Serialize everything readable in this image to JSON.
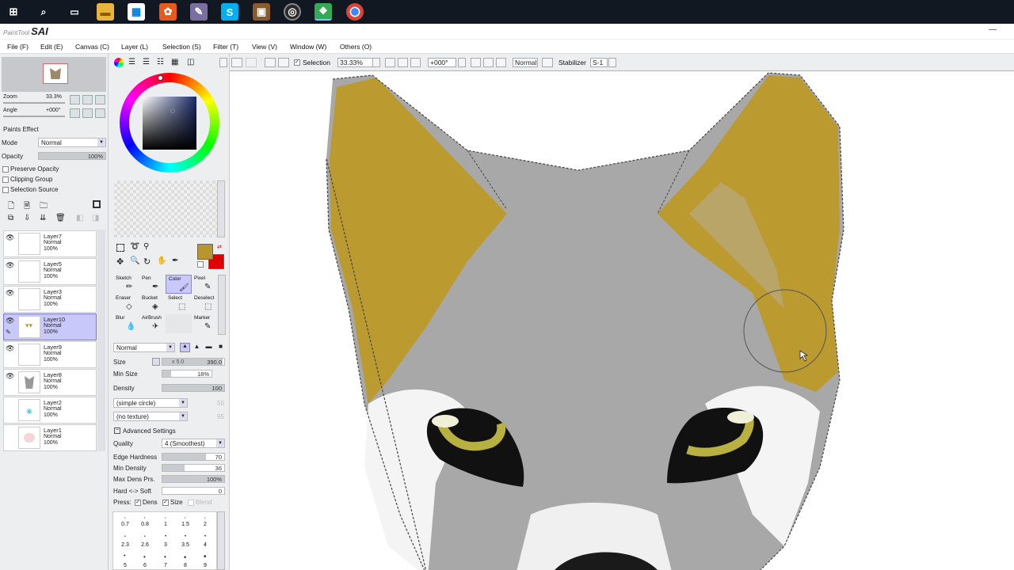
{
  "taskbar": {
    "icons": [
      "windows-icon",
      "search-icon",
      "task-view-icon",
      "file-explorer-icon",
      "store-icon",
      "app-icon",
      "app-icon",
      "skype-icon",
      "app-icon",
      "app-icon",
      "paint-tool-sai-icon",
      "chrome-icon"
    ]
  },
  "title": {
    "brand_small": "PaintTool",
    "brand": "SAI",
    "minimize": "—"
  },
  "menu": [
    {
      "label": "File (F)"
    },
    {
      "label": "Edit (E)"
    },
    {
      "label": "Canvas (C)"
    },
    {
      "label": "Layer (L)"
    },
    {
      "label": "Selection (S)"
    },
    {
      "label": "Filter (T)"
    },
    {
      "label": "View (V)"
    },
    {
      "label": "Window (W)"
    },
    {
      "label": "Others (O)"
    }
  ],
  "navigator": {
    "zoom_label": "Zoom",
    "zoom_value": "33.3%",
    "angle_label": "Angle",
    "angle_value": "+000°"
  },
  "paints": {
    "header": "Paints Effect",
    "mode_label": "Mode",
    "mode_value": "Normal",
    "opacity_label": "Opacity",
    "opacity_value": "100%",
    "opacity_fraction": 1.0,
    "preserve_opacity": "Preserve Opacity",
    "clipping_group": "Clipping Group",
    "selection_source": "Selection Source"
  },
  "layers": [
    {
      "name": "Layer7",
      "mode": "Normal",
      "opacity": "100%",
      "selected": false
    },
    {
      "name": "Layer5",
      "mode": "Normal",
      "opacity": "100%",
      "selected": false
    },
    {
      "name": "Layer3",
      "mode": "Normal",
      "opacity": "100%",
      "selected": false
    },
    {
      "name": "Layer10",
      "mode": "Normal",
      "opacity": "100%",
      "selected": true
    },
    {
      "name": "Layer9",
      "mode": "Normal",
      "opacity": "100%",
      "selected": false
    },
    {
      "name": "Layer8",
      "mode": "Normal",
      "opacity": "100%",
      "selected": false
    },
    {
      "name": "Layer2",
      "mode": "Normal",
      "opacity": "100%",
      "selected": false
    },
    {
      "name": "Layer1",
      "mode": "Normal",
      "opacity": "100%",
      "selected": false
    }
  ],
  "colors": {
    "primary": "#b7962e",
    "secondary": "#e00000",
    "ear_gold": "#bb9a30",
    "fur_gray": "#a8a8a8",
    "eye_yellow": "#b8b040"
  },
  "tools": {
    "row1": [
      "Sketch",
      "Pen",
      "Color",
      "Pixel"
    ],
    "row2": [
      "Eraser",
      "Bucket",
      "Select",
      "Deselect"
    ],
    "row3": [
      "Blur",
      "AirBrush",
      "",
      "Marker"
    ]
  },
  "brush": {
    "blend_mode": "Normal",
    "size_label": "Size",
    "size_mult": "x 5.0",
    "size_value": "390.0",
    "size_fraction": 0.98,
    "min_size_label": "Min Size",
    "min_size_value": "18%",
    "min_size_fraction": 0.18,
    "density_label": "Density",
    "density_value": "100",
    "density_fraction": 1.0,
    "shape": "(simple circle)",
    "shape_num": "50",
    "texture": "(no texture)",
    "texture_num": "95",
    "advanced": "Advanced Settings",
    "quality_label": "Quality",
    "quality_value": "4 (Smoothest)",
    "edge_label": "Edge Hardness",
    "edge_value": "70",
    "edge_fraction": 0.7,
    "min_density_label": "Min Density",
    "min_density_value": "36",
    "min_density_fraction": 0.36,
    "max_dens_label": "Max Dens Prs.",
    "max_dens_value": "100%",
    "max_dens_fraction": 1.0,
    "hard_soft_label": "Hard <-> Soft",
    "hard_soft_value": "0",
    "hard_soft_fraction": 0.0,
    "press_label": "Press:",
    "press_dens": "Dens",
    "press_size": "Size",
    "press_blend": "Blend",
    "size_presets_row1": [
      "0.7",
      "0.8",
      "1",
      "1.5",
      "2"
    ],
    "size_presets_row2": [
      "2.3",
      "2.6",
      "3",
      "3.5",
      "4"
    ],
    "size_presets_row3": [
      "5",
      "6",
      "7",
      "8",
      "9"
    ]
  },
  "toolbar": {
    "selection_label": "Selection",
    "zoom": "33.33%",
    "rotation": "+000°",
    "blend": "Normal",
    "stabilizer_label": "Stabilizer",
    "stabilizer_value": "S-1"
  }
}
